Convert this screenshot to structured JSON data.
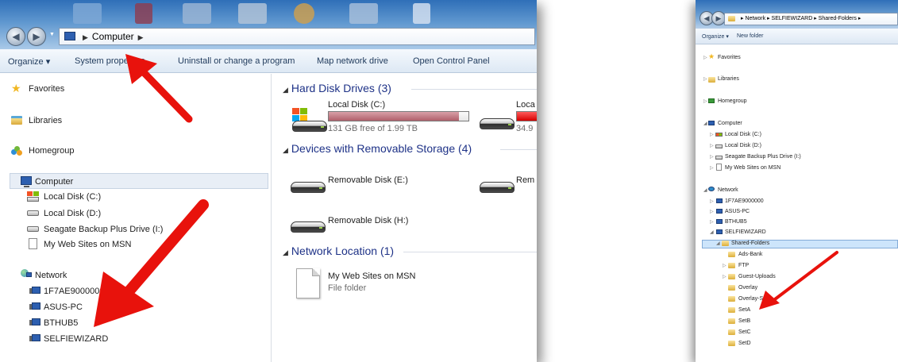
{
  "left_window": {
    "address": {
      "segments": [
        "Computer"
      ]
    },
    "toolbar": {
      "organize": "Organize ▾",
      "system_properties": "System properties",
      "uninstall": "Uninstall or change a program",
      "map_network_drive": "Map network drive",
      "open_control_panel": "Open Control Panel"
    },
    "nav": {
      "favorites": "Favorites",
      "libraries": "Libraries",
      "homegroup": "Homegroup",
      "computer": "Computer",
      "drives": [
        "Local Disk (C:)",
        "Local Disk (D:)",
        "Seagate Backup Plus Drive (I:)",
        "My Web Sites on MSN"
      ],
      "network": "Network",
      "network_items": [
        "1F7AE9000000",
        "ASUS-PC",
        "BTHUB5",
        "SELFIEWIZARD"
      ]
    },
    "content": {
      "groups": {
        "hard_disk": "Hard Disk Drives (3)",
        "removable": "Devices with Removable Storage (4)",
        "network_location": "Network Location (1)"
      },
      "drive_c": {
        "name": "Local Disk (C:)",
        "free": "131 GB free of 1.99 TB",
        "used_fraction": 0.93
      },
      "drive_d": {
        "name": "Loca",
        "free": "34.9",
        "used_fraction": 0.98
      },
      "removable": [
        "Removable Disk (E:)",
        "Rem",
        "Removable Disk (H:)"
      ],
      "web_site": {
        "name": "My Web Sites on MSN",
        "type": "File folder"
      }
    }
  },
  "right_window": {
    "address": "▸  Network  ▸  SELFIEWIZARD  ▸  Shared-Folders  ▸",
    "toolbar": {
      "organize": "Organize ▾",
      "new_folder": "New folder"
    },
    "tree": {
      "favorites": "Favorites",
      "libraries": "Libraries",
      "homegroup": "Homegroup",
      "computer": "Computer",
      "computer_items": [
        "Local Disk (C:)",
        "Local Disk (D:)",
        "Seagate Backup Plus Drive (I:)",
        "My Web Sites on MSN"
      ],
      "network": "Network",
      "network_items": [
        "1F7AE9000000",
        "ASUS-PC",
        "BTHUB5",
        "SELFIEWIZARD"
      ],
      "shared": "Shared-Folders",
      "folders": [
        "Ads-Bank",
        "FTP",
        "Guest-Uploads",
        "Overlay",
        "Overlay-S",
        "SetA",
        "SetB",
        "SetC",
        "SetD"
      ]
    }
  },
  "colors": {
    "arrow": "#e8120c",
    "aero": "#2f6fb8",
    "toolbar_text": "#1e395b",
    "group_header": "#1e3287"
  }
}
